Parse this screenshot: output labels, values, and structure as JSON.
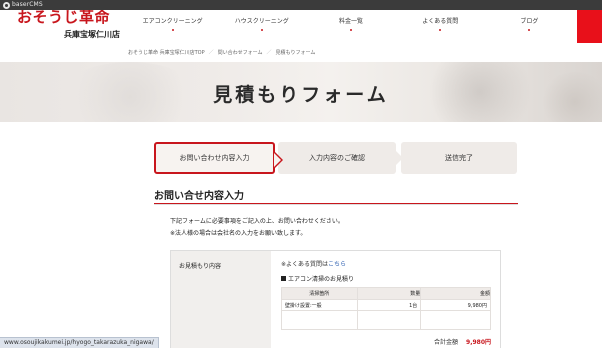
{
  "cms_bar": {
    "label": "baserCMS"
  },
  "brand": {
    "name": "おそうじ革命",
    "branch": "兵庫宝塚仁川店"
  },
  "gnav": {
    "items": [
      {
        "label": "エアコンクリーニング"
      },
      {
        "label": "ハウスクリーニング"
      },
      {
        "label": "料金一覧"
      },
      {
        "label": "よくある質問"
      },
      {
        "label": "ブログ"
      }
    ]
  },
  "breadcrumb": {
    "items": [
      "おそうじ革命 兵庫宝塚仁川店TOP",
      "問い合わせフォーム",
      "見積もりフォーム"
    ],
    "separator": "／"
  },
  "hero": {
    "title": "見積もりフォーム"
  },
  "steps": [
    {
      "label": "お問い合わせ内容入力",
      "active": true
    },
    {
      "label": "入力内容のご確認",
      "active": false
    },
    {
      "label": "送信完了",
      "active": false
    }
  ],
  "section": {
    "title": "お問い合せ内容入力",
    "intro": [
      "下記フォームに必要事項をご記入の上、お問い合わせください。",
      "※法人様の場合は会社名の入力をお願い致します。"
    ]
  },
  "form": {
    "label": "お見積もり内容",
    "faq_prefix": "※よくある質問は",
    "faq_link": "こちら",
    "subtitle": "エアコン清掃のお見積り",
    "table": {
      "headers": [
        "清掃箇所",
        "数量",
        "金額"
      ],
      "rows": [
        {
          "place": "壁掛け設置:一般",
          "qty": "1台",
          "price": "9,980円"
        }
      ]
    },
    "total_label": "合計金額",
    "total_value": "9,980円"
  },
  "status_url": "www.osoujikakumei.jp/hyogo_takarazuka_nigawa/",
  "colors": {
    "accent": "#c8161d",
    "cms_bar": "#3b3b3b",
    "step_bg": "#efebe8"
  }
}
